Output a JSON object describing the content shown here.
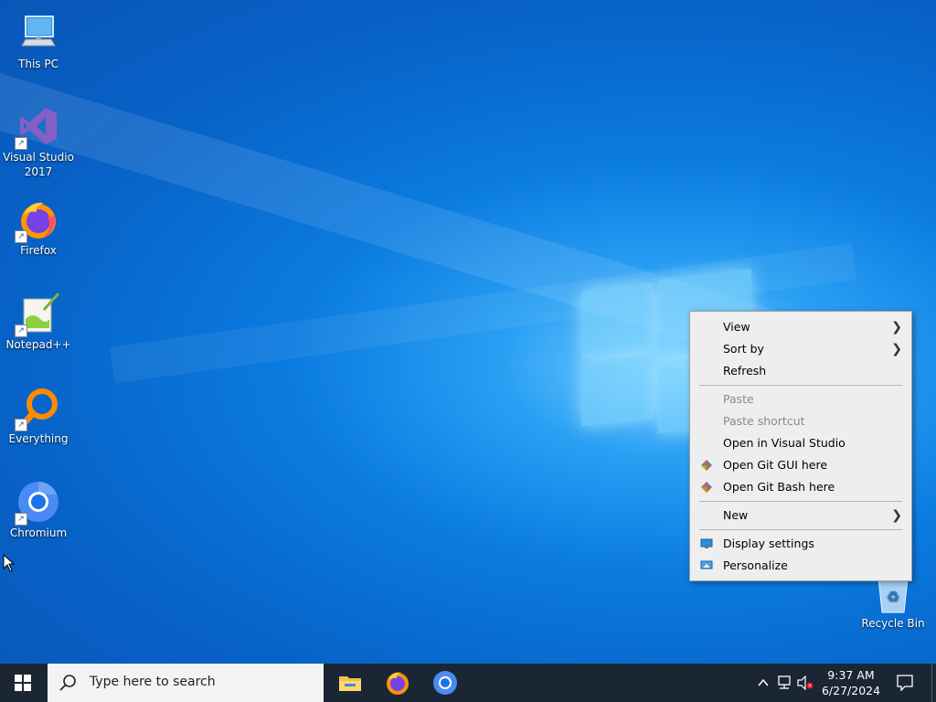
{
  "desktop_icons": [
    {
      "id": "this-pc",
      "label": "This PC",
      "icon": "computer-icon"
    },
    {
      "id": "visual-studio",
      "label": "Visual Studio 2017",
      "icon": "visual-studio-icon"
    },
    {
      "id": "firefox",
      "label": "Firefox",
      "icon": "firefox-icon"
    },
    {
      "id": "notepad-plus-plus",
      "label": "Notepad++",
      "icon": "notepad-plus-plus-icon"
    },
    {
      "id": "everything",
      "label": "Everything",
      "icon": "everything-search-icon"
    },
    {
      "id": "chromium",
      "label": "Chromium",
      "icon": "chromium-icon"
    }
  ],
  "recycle_bin": {
    "label": "Recycle Bin",
    "icon": "recycle-bin-icon"
  },
  "context_menu": {
    "items": [
      {
        "label": "View",
        "has_submenu": true,
        "enabled": true
      },
      {
        "label": "Sort by",
        "has_submenu": true,
        "enabled": true
      },
      {
        "label": "Refresh",
        "enabled": true
      },
      {
        "label": "Paste",
        "enabled": false
      },
      {
        "label": "Paste shortcut",
        "enabled": false
      },
      {
        "label": "Open in Visual Studio",
        "enabled": true
      },
      {
        "label": "Open Git GUI here",
        "enabled": true,
        "icon": "git-icon"
      },
      {
        "label": "Open Git Bash here",
        "enabled": true,
        "icon": "git-icon"
      },
      {
        "label": "New",
        "has_submenu": true,
        "enabled": true
      },
      {
        "label": "Display settings",
        "enabled": true,
        "icon": "display-settings-icon"
      },
      {
        "label": "Personalize",
        "enabled": true,
        "icon": "personalize-icon"
      }
    ]
  },
  "taskbar": {
    "search_placeholder": "Type here to search",
    "pinned_apps": [
      "file-explorer-icon",
      "firefox-icon",
      "chromium-icon"
    ],
    "clock_time": "9:37 AM",
    "clock_date": "6/27/2024"
  },
  "colors": {
    "taskbar": "#1b2634",
    "menu_bg": "#eeeeee",
    "accent": "#0078d7"
  }
}
